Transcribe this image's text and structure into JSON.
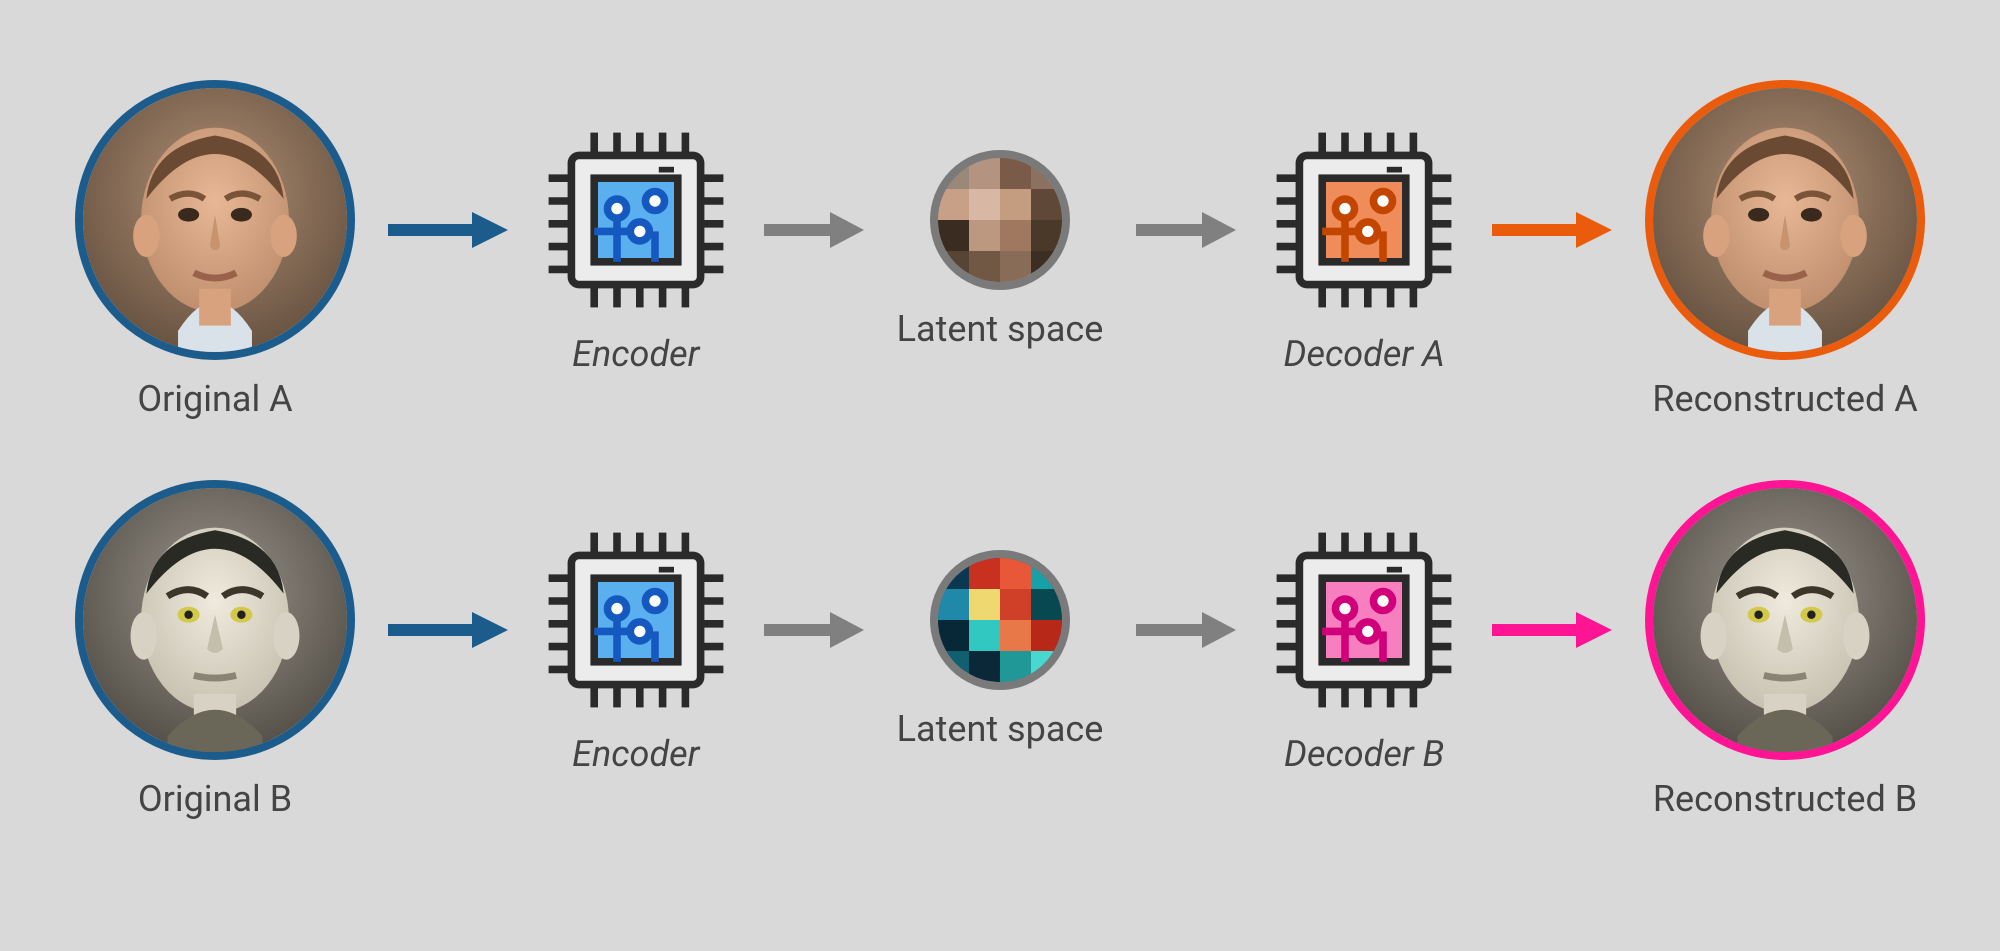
{
  "colors": {
    "blue": "#1c5c8c",
    "orange": "#ea5b0c",
    "pink": "#ff1493",
    "grey": "#808080"
  },
  "rowA": {
    "original": "Original A",
    "encoder": "Encoder",
    "latent": "Latent space",
    "decoder": "Decoder A",
    "reconstructed": "Reconstructed A"
  },
  "rowB": {
    "original": "Original B",
    "encoder": "Encoder",
    "latent": "Latent space",
    "decoder": "Decoder B",
    "reconstructed": "Reconstructed B"
  }
}
